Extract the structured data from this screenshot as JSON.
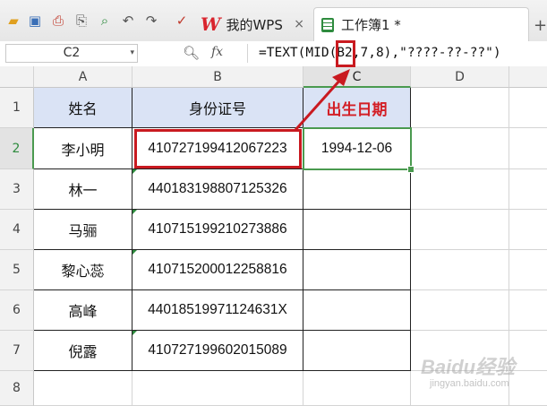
{
  "toolbar": {
    "icons": [
      "folder-open-icon",
      "save-icon",
      "export-pdf-icon",
      "print-icon",
      "print-preview-icon",
      "undo-icon",
      "redo-icon",
      "format-painter-icon"
    ]
  },
  "tabs": [
    {
      "label": "我的WPS",
      "close": "×"
    },
    {
      "label": "工作簿1 *",
      "close": ""
    }
  ],
  "formula_bar": {
    "name_box": "C2",
    "fx": "fx",
    "formula": "=TEXT(MID(B2,7,8),\"????-??-??\")"
  },
  "columns": [
    "A",
    "B",
    "C",
    "D"
  ],
  "rows": [
    "1",
    "2",
    "3",
    "4",
    "5",
    "6",
    "7",
    "8"
  ],
  "headers": {
    "name": "姓名",
    "id": "身份证号",
    "birth": "出生日期"
  },
  "people": [
    {
      "name": "李小明",
      "id": "410727199412067223",
      "birth": "1994-12-06"
    },
    {
      "name": "林一",
      "id": "440183198807125326",
      "birth": ""
    },
    {
      "name": "马骊",
      "id": "410715199210273886",
      "birth": ""
    },
    {
      "name": "黎心蕊",
      "id": "410715200012258816",
      "birth": ""
    },
    {
      "name": "高峰",
      "id": "44018519971124631X",
      "birth": ""
    },
    {
      "name": "倪露",
      "id": "410727199602015089",
      "birth": ""
    }
  ],
  "colors": {
    "header_fill": "#dae3f5",
    "accent_red": "#d31f26",
    "selection_green": "#4a9a4f"
  },
  "watermark": {
    "text": "Baidu经验",
    "sub": "jingyan.baidu.com"
  }
}
